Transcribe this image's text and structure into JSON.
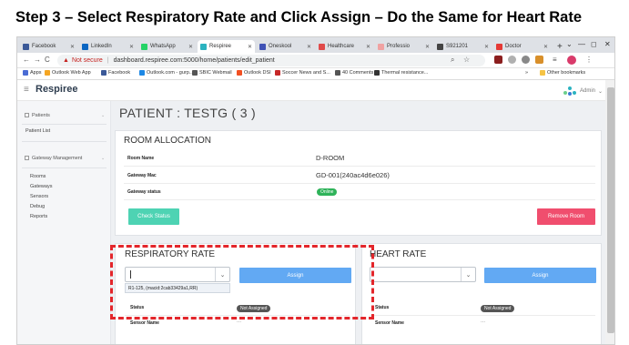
{
  "slide_title": "Step 3 – Select Respiratory Rate and Click Assign – Do the Same for Heart Rate",
  "browser": {
    "tabs": [
      {
        "label": "Facebook",
        "color": "#3b5998"
      },
      {
        "label": "LinkedIn",
        "color": "#0a66c2"
      },
      {
        "label": "WhatsApp",
        "color": "#25d366"
      },
      {
        "label": "Respiree",
        "color": "#2bb3c0"
      },
      {
        "label": "Oneskool",
        "color": "#3f51b5"
      },
      {
        "label": "Healthcare",
        "color": "#e04a4a"
      },
      {
        "label": "Professio",
        "color": "#f0a2a2"
      },
      {
        "label": "S921201",
        "color": "#444444"
      },
      {
        "label": "Doctor",
        "color": "#e53935"
      }
    ],
    "new_tab": "+",
    "win_min": "—",
    "win_max": "◻",
    "win_close": "✕",
    "not_secure": "Not secure",
    "url": "dashboard.respiree.com:5000/home/patients/edit_patient",
    "bookmarks": [
      {
        "label": "Apps",
        "color": "#4a6cd4"
      },
      {
        "label": "Outlook Web App",
        "color": "#f5a623"
      },
      {
        "label": "Facebook",
        "color": "#3b5998"
      },
      {
        "label": "Outlook.com - gurp...",
        "color": "#1e88e5"
      },
      {
        "label": "SBIC Webmail",
        "color": "#555555"
      },
      {
        "label": "Outlook DSI",
        "color": "#f25022"
      },
      {
        "label": "Soccer News and S...",
        "color": "#c62828"
      },
      {
        "label": "40 Comments",
        "color": "#555555"
      },
      {
        "label": "Thermal resistance...",
        "color": "#333333"
      },
      {
        "label": "Other bookmarks",
        "color": "#f6c344"
      }
    ],
    "bm_more": "»"
  },
  "app": {
    "brand": "Respiree",
    "user": "Admin",
    "sidebar": {
      "patients": "Patients",
      "patient_list": "Patient List",
      "gateway_mgmt": "Gateway Management",
      "sub_items": [
        "Rooms",
        "Gateways",
        "Sensors",
        "Debug",
        "Reports"
      ]
    },
    "page_title": "PATIENT : TESTG ( 3 )",
    "room": {
      "title": "ROOM ALLOCATION",
      "rows": [
        {
          "label": "Room Name",
          "value": "D-ROOM"
        },
        {
          "label": "Gateway Mac",
          "value": "GD-001(240ac4d6e026)"
        },
        {
          "label": "Gateway status",
          "value": "Online"
        }
      ],
      "check_status": "Check Status",
      "remove_room": "Remove Room"
    },
    "respiratory": {
      "title": "RESPIRATORY RATE",
      "assign": "Assign",
      "option": "R1-125, (macid:2cab33429a1,RR)",
      "status_label": "Status",
      "status_value": "Not Assigned",
      "sensor_label": "Sensor Name",
      "sensor_value": "..."
    },
    "heart": {
      "title": "HEART RATE",
      "assign": "Assign",
      "status_label": "Status",
      "status_value": "Not Assigned",
      "sensor_label": "Sensor Name",
      "sensor_value": "..."
    }
  },
  "colors": {
    "online": "#2fb35a",
    "check_status": "#4ed3b3",
    "remove_room": "#f04e6e",
    "assign": "#62a9f3",
    "badge_dark": "#555555",
    "highlight": "#e3262b"
  }
}
